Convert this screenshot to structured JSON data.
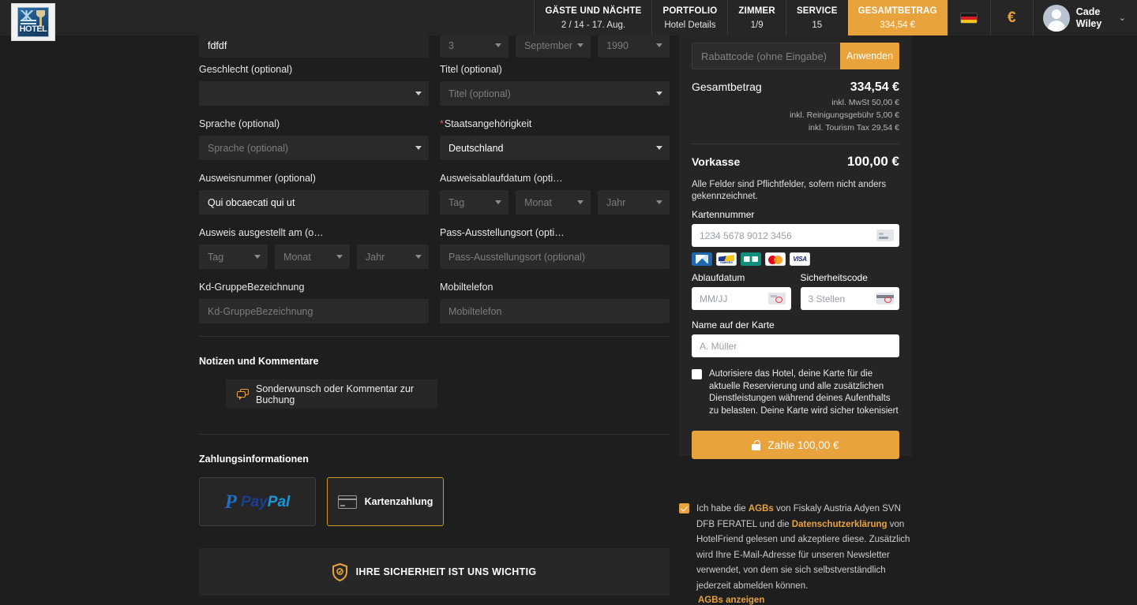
{
  "brand": {
    "logo_text": "HOTEL"
  },
  "topbar": {
    "cells": [
      {
        "title": "GÄSTE UND NÄCHTE",
        "value": "2 / 14 - 17. Aug.",
        "active": false,
        "wide": true
      },
      {
        "title": "PORTFOLIO",
        "value": "Hotel Details",
        "active": false,
        "wide": false
      },
      {
        "title": "ZIMMER",
        "value": "1/9",
        "active": false,
        "wide": false
      },
      {
        "title": "SERVICE",
        "value": "15",
        "active": false,
        "wide": false
      },
      {
        "title": "GESAMTBETRAG",
        "value": "334,54 €",
        "active": true,
        "wide": true
      }
    ],
    "language_icon": "german-flag-icon",
    "currency_symbol": "€",
    "user_name": "Cade Wiley",
    "chevron": "⌄"
  },
  "form": {
    "cut_row": {
      "name_value": "fdfdf",
      "day": "3",
      "month": "September",
      "year": "1990"
    },
    "fields": {
      "gender_label": "Geschlecht (optional)",
      "gender_value": "",
      "title_label": "Titel (optional)",
      "title_placeholder": "Titel (optional)",
      "language_label": "Sprache (optional)",
      "language_placeholder": "Sprache (optional)",
      "nationality_label": "Staatsangehörigkeit",
      "nationality_required_mark": "*",
      "nationality_value": "Deutschland",
      "id_number_label": "Ausweisnummer (optional)",
      "id_number_value": "Qui obcaecati qui ut",
      "id_expiry_label": "Ausweisablaufdatum (opti…",
      "id_issued_label": "Ausweis ausgestellt am (o…",
      "passport_place_label": "Pass-Ausstellungsort (opti…",
      "passport_place_placeholder": "Pass-Ausstellungsort (optional)",
      "group_label": "Kd-GruppeBezeichnung",
      "group_placeholder": "Kd-GruppeBezeichnung",
      "mobile_label": "Mobiltelefon",
      "mobile_placeholder": "Mobiltelefon",
      "day_placeholder": "Tag",
      "month_placeholder": "Monat",
      "year_placeholder": "Jahr"
    },
    "notes_heading": "Notizen und Kommentare",
    "notes_button": "Sonderwunsch oder Kommentar zur Buchung",
    "payment_heading": "Zahlungsinformationen",
    "paypal_glyph": "P",
    "paypal_pay": "Pay",
    "paypal_pal": "Pal",
    "card_payment_label": "Kartenzahlung",
    "security_banner": "IHRE SICHERHEIT IST UNS WICHTIG"
  },
  "summary": {
    "promo_placeholder": "Rabattcode (ohne Eingabe)",
    "promo_button": "Anwenden",
    "total_label": "Gesamtbetrag",
    "total_value": "334,54 €",
    "breakdown": [
      "inkl. MwSt 50,00 €",
      "inkl. Reinigungsgebühr 5,00 €",
      "inkl. Tourism Tax 29,54 €"
    ],
    "prepay_label": "Vorkasse",
    "prepay_value": "100,00 €",
    "mandatory_note": "Alle Felder sind Pflichtfelder, sofern nicht anders gekennzeichnet.",
    "card_number_label": "Kartennummer",
    "card_number_placeholder": "1234 5678 9012 3456",
    "brands": [
      "amex",
      "maestro",
      "cb",
      "mastercard",
      "visa"
    ],
    "maestro_word": "maestro",
    "visa_word": "VISA",
    "expiry_label": "Ablaufdatum",
    "expiry_placeholder": "MM/JJ",
    "cvc_label": "Sicherheitscode",
    "cvc_placeholder": "3 Stellen",
    "cardholder_label": "Name auf der Karte",
    "cardholder_placeholder": "A. Müller",
    "authorize_text": "Autorisiere das Hotel, deine Karte für die aktuelle Reservierung und alle zusätzlichen Dienstleistungen während deines Aufenthalts zu belasten. Deine Karte wird sicher tokenisiert",
    "pay_button": "Zahle 100,00 €"
  },
  "terms": {
    "part1": "Ich habe die ",
    "link1": "AGBs",
    "part2": " von Fiskaly Austria Adyen SVN DFB FERATEL und die ",
    "link2": "Datenschutzerklärung",
    "part3": " von HotelFriend gelesen und akzeptiere diese. Zusätzlich wird Ihre E-Mail-Adresse für unseren Newsletter verwendet, von dem sie sich selbstverständlich jederzeit abmelden können.",
    "show_terms": "AGBs anzeigen"
  },
  "colors": {
    "accent": "#e8a33d",
    "page_bg": "#1e1e1e",
    "panel_bg": "#252525",
    "field_bg": "#2a2a2a"
  }
}
